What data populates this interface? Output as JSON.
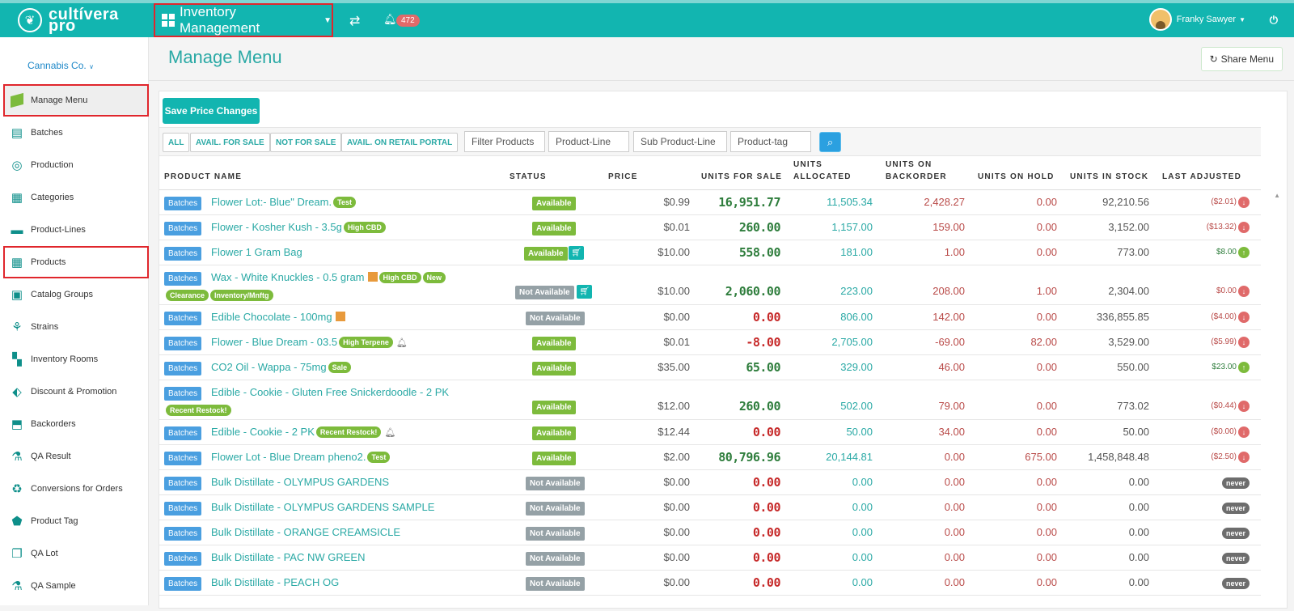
{
  "brand": {
    "line1": "cultívera",
    "line2": "pro"
  },
  "topbar": {
    "module": "Inventory Management",
    "notifications": "472",
    "user": "Franky Sawyer"
  },
  "sidebar": {
    "company": "Cannabis Co.",
    "items": [
      {
        "label": "Manage Menu"
      },
      {
        "label": "Batches"
      },
      {
        "label": "Production"
      },
      {
        "label": "Categories"
      },
      {
        "label": "Product-Lines"
      },
      {
        "label": "Products"
      },
      {
        "label": "Catalog Groups"
      },
      {
        "label": "Strains"
      },
      {
        "label": "Inventory Rooms"
      },
      {
        "label": "Discount & Promotion"
      },
      {
        "label": "Backorders"
      },
      {
        "label": "QA Result"
      },
      {
        "label": "Conversions for Orders"
      },
      {
        "label": "Product Tag"
      },
      {
        "label": "QA Lot"
      },
      {
        "label": "QA Sample"
      }
    ]
  },
  "header": {
    "title": "Manage Menu",
    "share": "Share Menu"
  },
  "toolbar": {
    "save": "Save Price Changes"
  },
  "filters": {
    "all": "ALL",
    "avail": "AVAIL. FOR SALE",
    "not": "NOT FOR SALE",
    "retail": "AVAIL. ON RETAIL PORTAL",
    "filter_placeholder": "Filter Products",
    "line_placeholder": "Product-Line",
    "sub_placeholder": "Sub Product-Line",
    "tag_placeholder": "Product-tag"
  },
  "columns": {
    "name": "PRODUCT NAME",
    "status": "STATUS",
    "price": "PRICE",
    "ufs": "UNITS FOR SALE",
    "alloc1": "UNITS",
    "alloc2": "ALLOCATED",
    "back1": "UNITS ON",
    "back2": "BACKORDER",
    "hold": "UNITS ON HOLD",
    "stock": "UNITS IN STOCK",
    "adj": "LAST ADJUSTED"
  },
  "batches_label": "Batches",
  "rows": [
    {
      "name": "Flower Lot:- Blue\" Dream.",
      "tags": [
        "Test"
      ],
      "status": "Available",
      "price": "$0.99",
      "ufs": "16,951.77",
      "alloc": "11,505.34",
      "back": "2,428.27",
      "hold": "0.00",
      "stock": "92,210.56",
      "adj": "($2.01)"
    },
    {
      "name": "Flower - Kosher Kush - 3.5g",
      "tags": [
        "High CBD"
      ],
      "status": "Available",
      "price": "$0.01",
      "ufs": "260.00",
      "alloc": "1,157.00",
      "back": "159.00",
      "hold": "0.00",
      "stock": "3,152.00",
      "adj": "($13.32)"
    },
    {
      "name": "Flower 1 Gram Bag",
      "tags": [],
      "status": "Available",
      "price": "$10.00",
      "ufs": "558.00",
      "alloc": "181.00",
      "back": "1.00",
      "hold": "0.00",
      "stock": "773.00",
      "adj": "$8.00"
    },
    {
      "name": "Wax - White Knuckles - 0.5 gram",
      "tags": [
        "High CBD",
        "New"
      ],
      "tags2": [
        "Clearance",
        "Inventory/Mnftg"
      ],
      "status": "Not Available",
      "price": "$10.00",
      "ufs": "2,060.00",
      "alloc": "223.00",
      "back": "208.00",
      "hold": "1.00",
      "stock": "2,304.00",
      "adj": "$0.00"
    },
    {
      "name": "Edible Chocolate - 100mg",
      "tags": [],
      "status": "Not Available",
      "price": "$0.00",
      "ufs": "0.00",
      "alloc": "806.00",
      "back": "142.00",
      "hold": "0.00",
      "stock": "336,855.85",
      "adj": "($4.00)"
    },
    {
      "name": "Flower - Blue Dream - 03.5",
      "tags": [
        "High Terpene"
      ],
      "status": "Available",
      "price": "$0.01",
      "ufs": "-8.00",
      "alloc": "2,705.00",
      "back": "-69.00",
      "hold": "82.00",
      "stock": "3,529.00",
      "adj": "($5.99)"
    },
    {
      "name": "CO2 Oil - Wappa - 75mg",
      "tags": [
        "Sale"
      ],
      "status": "Available",
      "price": "$35.00",
      "ufs": "65.00",
      "alloc": "329.00",
      "back": "46.00",
      "hold": "0.00",
      "stock": "550.00",
      "adj": "$23.00"
    },
    {
      "name": "Edible - Cookie - Gluten Free Snickerdoodle - 2 PK",
      "tags": [],
      "tags2": [
        "Recent Restock!"
      ],
      "status": "Available",
      "price": "$12.00",
      "ufs": "260.00",
      "alloc": "502.00",
      "back": "79.00",
      "hold": "0.00",
      "stock": "773.02",
      "adj": "($0.44)"
    },
    {
      "name": "Edible - Cookie - 2 PK",
      "tags": [
        "Recent Restock!"
      ],
      "status": "Available",
      "price": "$12.44",
      "ufs": "0.00",
      "alloc": "50.00",
      "back": "34.00",
      "hold": "0.00",
      "stock": "50.00",
      "adj": "($0.00)"
    },
    {
      "name": "Flower Lot - Blue Dream pheno2.",
      "tags": [
        "Test"
      ],
      "status": "Available",
      "price": "$2.00",
      "ufs": "80,796.96",
      "alloc": "20,144.81",
      "back": "0.00",
      "hold": "675.00",
      "stock": "1,458,848.48",
      "adj": "($2.50)"
    },
    {
      "name": "Bulk Distillate - OLYMPUS GARDENS",
      "tags": [],
      "status": "Not Available",
      "price": "$0.00",
      "ufs": "0.00",
      "alloc": "0.00",
      "back": "0.00",
      "hold": "0.00",
      "stock": "0.00",
      "adj": "never"
    },
    {
      "name": "Bulk Distillate - OLYMPUS GARDENS SAMPLE",
      "tags": [],
      "status": "Not Available",
      "price": "$0.00",
      "ufs": "0.00",
      "alloc": "0.00",
      "back": "0.00",
      "hold": "0.00",
      "stock": "0.00",
      "adj": "never"
    },
    {
      "name": "Bulk Distillate - ORANGE CREAMSICLE",
      "tags": [],
      "status": "Not Available",
      "price": "$0.00",
      "ufs": "0.00",
      "alloc": "0.00",
      "back": "0.00",
      "hold": "0.00",
      "stock": "0.00",
      "adj": "never"
    },
    {
      "name": "Bulk Distillate - PAC NW GREEN",
      "tags": [],
      "status": "Not Available",
      "price": "$0.00",
      "ufs": "0.00",
      "alloc": "0.00",
      "back": "0.00",
      "hold": "0.00",
      "stock": "0.00",
      "adj": "never"
    },
    {
      "name": "Bulk Distillate - PEACH OG",
      "tags": [],
      "status": "Not Available",
      "price": "$0.00",
      "ufs": "0.00",
      "alloc": "0.00",
      "back": "0.00",
      "hold": "0.00",
      "stock": "0.00",
      "adj": "never"
    }
  ]
}
